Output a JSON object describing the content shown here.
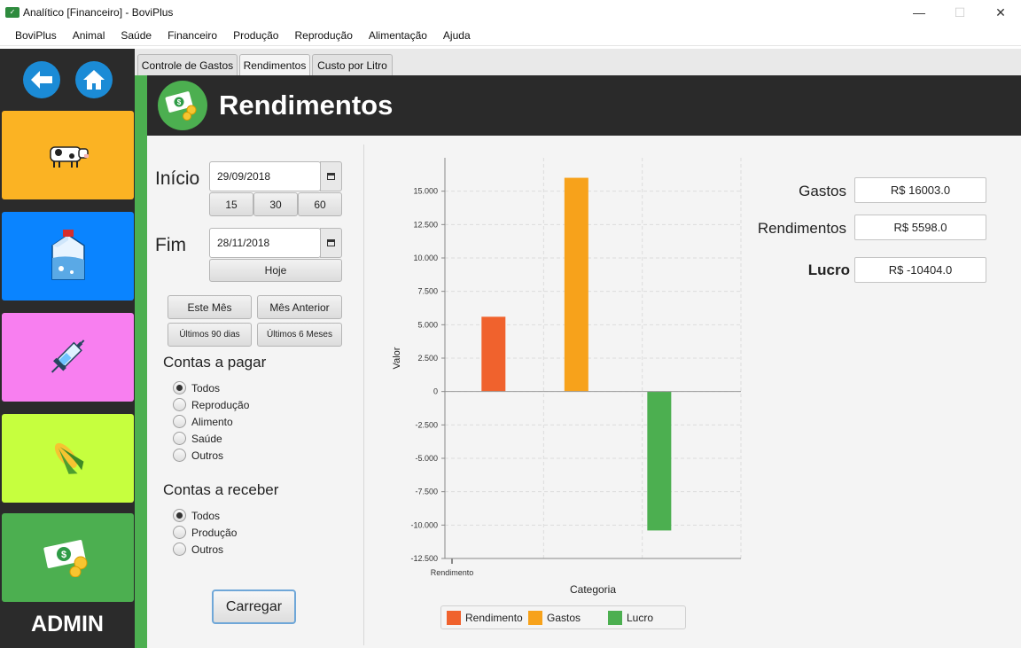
{
  "window": {
    "title": "Analítico [Financeiro] - BoviPlus",
    "minimize": "—",
    "maximize": "☐",
    "close": "✕"
  },
  "menu": [
    "BoviPlus",
    "Animal",
    "Saúde",
    "Financeiro",
    "Produção",
    "Reprodução",
    "Alimentação",
    "Ajuda"
  ],
  "sidebar": {
    "admin_label": "ADMIN"
  },
  "tabs": [
    "Controle de Gastos",
    "Rendimentos",
    "Custo por Litro"
  ],
  "header": {
    "title": "Rendimentos"
  },
  "form": {
    "inicio_label": "Início",
    "inicio_value": "29/09/2018",
    "quick_days": [
      "15",
      "30",
      "60"
    ],
    "fim_label": "Fim",
    "fim_value": "28/11/2018",
    "hoje": "Hoje",
    "este_mes": "Este Mês",
    "mes_anterior": "Mês Anterior",
    "ultimos_90": "Últimos 90 dias",
    "ultimos_6": "Últimos 6 Meses",
    "pagar_title": "Contas a pagar",
    "pagar_options": [
      "Todos",
      "Reprodução",
      "Alimento",
      "Saúde",
      "Outros"
    ],
    "receber_title": "Contas a receber",
    "receber_options": [
      "Todos",
      "Produção",
      "Outros"
    ],
    "carregar": "Carregar"
  },
  "summary": {
    "gastos_label": "Gastos",
    "gastos_value": "R$ 16003.0",
    "rendimentos_label": "Rendimentos",
    "rendimentos_value": "R$ 5598.0",
    "lucro_label": "Lucro",
    "lucro_value": "R$ -10404.0"
  },
  "chart_data": {
    "type": "bar",
    "xlabel": "Categoria",
    "ylabel": "Valor",
    "category_tick_label": "Rendimento",
    "ylim": [
      -12500,
      17500
    ],
    "yticks": [
      -12500,
      -10000,
      -7500,
      -5000,
      -2500,
      0,
      2500,
      5000,
      7500,
      10000,
      12500,
      15000
    ],
    "ytick_labels": [
      "-12.500",
      "-10.000",
      "-7.500",
      "-5.000",
      "-2.500",
      "0",
      "2.500",
      "5.000",
      "7.500",
      "10.000",
      "12.500",
      "15.000"
    ],
    "grid": true,
    "legend": "bottom",
    "series": [
      {
        "name": "Rendimento",
        "value": 5598,
        "color": "#f0622d"
      },
      {
        "name": "Gastos",
        "value": 16003,
        "color": "#f7a21b"
      },
      {
        "name": "Lucro",
        "value": -10404,
        "color": "#4caf50"
      }
    ]
  },
  "colors": {
    "sidebar_bg": "#2b2b2b",
    "accent_green": "#4caf50",
    "nav_blue": "#1b8bd6",
    "tile_animal": "#fbb323",
    "tile_producao": "#0a84ff",
    "tile_saude": "#f87ff0",
    "tile_alimentacao": "#c6ff3e",
    "tile_financeiro": "#4caf50"
  }
}
